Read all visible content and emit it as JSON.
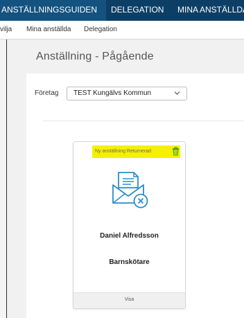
{
  "topnav": {
    "tabs": [
      {
        "label": "ANSTÄLLNINGSGUIDEN",
        "active": true
      },
      {
        "label": "DELEGATION",
        "active": false
      },
      {
        "label": "MINA ANSTÄLLDA",
        "active": false
      }
    ]
  },
  "subnav": {
    "items": [
      {
        "label": "vilja"
      },
      {
        "label": "Mina anställda"
      },
      {
        "label": "Delegation"
      }
    ]
  },
  "page": {
    "title": "Anställning - Pågående"
  },
  "filter": {
    "company_label": "Företag",
    "company_value": "TEST Kungälvs Kommun"
  },
  "card": {
    "status_text": "Ny anställning Returnerad",
    "status_highlight_color": "#f5f000",
    "status_icon": "trash-icon",
    "mail_icon": "mail-returned-icon",
    "name": "Daniel Alfredsson",
    "role": "Barnskötare",
    "footer_label": "Visa"
  },
  "colors": {
    "nav_bg": "#0d3f66",
    "nav_active_bg": "#14527f",
    "icon_blue": "#2a8cc8",
    "trash_green": "#3a9a2a"
  }
}
